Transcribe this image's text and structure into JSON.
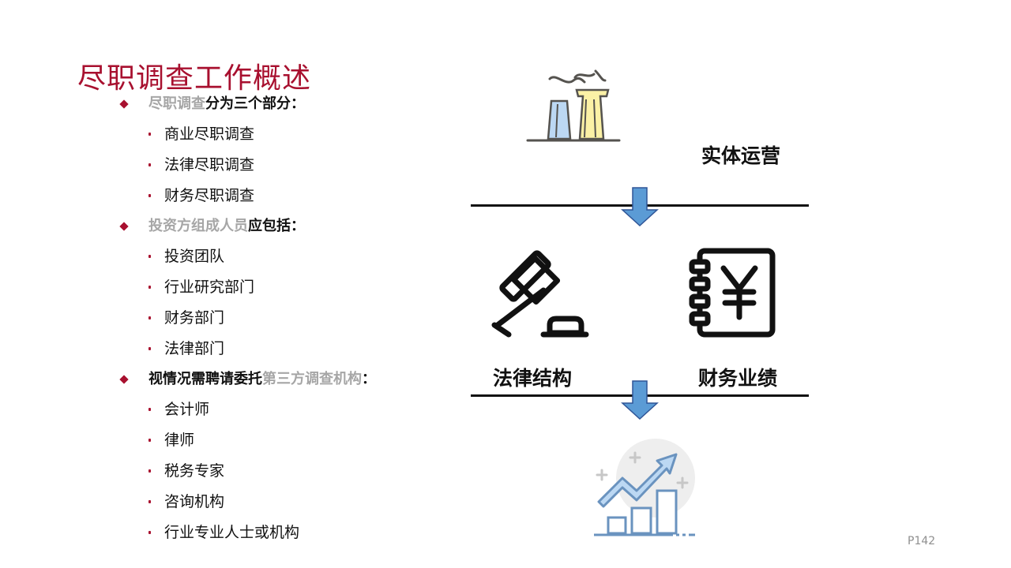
{
  "slide": {
    "title": "尽职调查工作概述",
    "page_number": "P142"
  },
  "sections": [
    {
      "grey": "尽职调查",
      "black": "分为三个部分：",
      "items": [
        "商业尽职调查",
        "法律尽职调查",
        "财务尽职调查"
      ]
    },
    {
      "grey": "投资方组成人员",
      "black": "应包括：",
      "items": [
        "投资团队",
        "行业研究部门",
        "财务部门",
        "法律部门"
      ]
    },
    {
      "black": "视情况需聘请委托",
      "grey": "第三方调查机构",
      "tail": "：",
      "items": [
        "会计师",
        "律师",
        "税务专家",
        "咨询机构",
        "行业专业人士或机构"
      ]
    }
  ],
  "diagram": {
    "top_label": "实体运营",
    "left_label": "法律结构",
    "right_label": "财务业绩",
    "icons": [
      "factory-icon",
      "gavel-icon",
      "yen-ledger-icon",
      "growth-chart-icon"
    ],
    "colors": {
      "accent": "#a8102f",
      "arrow": "#5b9bd5",
      "muted": "#a6a6a6"
    }
  }
}
